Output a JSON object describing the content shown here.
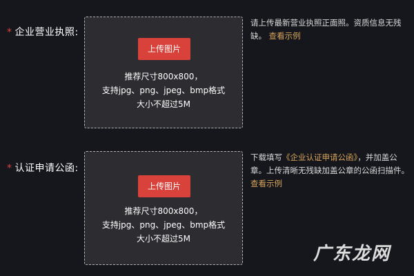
{
  "colors": {
    "background": "#16171d",
    "box_background": "#2c2c31",
    "accent_button": "#d9423b",
    "required_star": "#e0413a",
    "link": "#d6a45a"
  },
  "license": {
    "required_mark": "*",
    "label": "企业营业执照:",
    "upload_button": "上传图片",
    "hint_lines": [
      "推荐尺寸800x800，",
      "支持jpg、png、jpeg、bmp格式",
      "大小不超过5M"
    ],
    "note_line1": "请上传最新营业执照正面照。资质信息无残",
    "note_line2_text": "缺。",
    "note_link": "查看示例"
  },
  "authorization": {
    "required_mark": "*",
    "label": "认证申请公函:",
    "upload_button": "上传图片",
    "hint_lines": [
      "推荐尺寸800x800，",
      "支持jpg、png、jpeg、bmp格式",
      "大小不超过5M"
    ],
    "note_line1_prefix": "下载填写",
    "note_line1_link": "《企业认证申请公函》",
    "note_line1_suffix": "，并加盖公",
    "note_line2": "章。上传清晰无残缺加盖公章的公函扫描件。",
    "note_link": "查看示例"
  },
  "watermark": "广东龙网"
}
